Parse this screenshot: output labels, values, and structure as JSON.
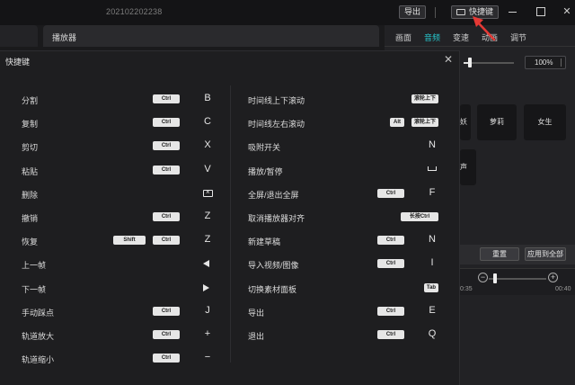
{
  "titlebar": {
    "project_name": "202102202238",
    "export_label": "导出",
    "shortcuts_label": "快捷键"
  },
  "player": {
    "title": "播放器"
  },
  "right_panel": {
    "tabs": [
      {
        "label": "画面",
        "active": false
      },
      {
        "label": "音频",
        "active": true
      },
      {
        "label": "变速",
        "active": false
      },
      {
        "label": "动画",
        "active": false
      },
      {
        "label": "调节",
        "active": false
      }
    ],
    "volume_percent": "100%",
    "volume_level": 0.1,
    "voices": [
      "妖",
      "萝莉",
      "女生",
      "声"
    ],
    "reset_label": "重置",
    "apply_all_label": "应用到全部",
    "timeline_times": [
      "0:35",
      "00:40"
    ]
  },
  "dialog": {
    "title": "快捷键",
    "left_column": [
      {
        "name": "分割",
        "mods": [
          "Ctrl"
        ],
        "key": "B"
      },
      {
        "name": "复制",
        "mods": [
          "Ctrl"
        ],
        "key": "C"
      },
      {
        "name": "剪切",
        "mods": [
          "Ctrl"
        ],
        "key": "X"
      },
      {
        "name": "粘贴",
        "mods": [
          "Ctrl"
        ],
        "key": "V"
      },
      {
        "name": "删除",
        "mods": [],
        "key": "",
        "glyph": "delete-key-icon"
      },
      {
        "name": "撤销",
        "mods": [
          "Ctrl"
        ],
        "key": "Z"
      },
      {
        "name": "恢复",
        "mods": [
          "Shift",
          "Ctrl"
        ],
        "key": "Z"
      },
      {
        "name": "上一帧",
        "mods": [],
        "key": "",
        "glyph": "arrow-left-icon"
      },
      {
        "name": "下一帧",
        "mods": [],
        "key": "",
        "glyph": "arrow-right-icon"
      },
      {
        "name": "手动踩点",
        "mods": [
          "Ctrl"
        ],
        "key": "J"
      },
      {
        "name": "轨道放大",
        "mods": [
          "Ctrl"
        ],
        "key": "+"
      },
      {
        "name": "轨道缩小",
        "mods": [
          "Ctrl"
        ],
        "key": "−"
      }
    ],
    "right_column": [
      {
        "name": "时间线上下滚动",
        "mods": [
          "滚轮上下"
        ],
        "key": ""
      },
      {
        "name": "时间线左右滚动",
        "mods": [
          "Alt",
          "滚轮上下"
        ],
        "key": ""
      },
      {
        "name": "吸附开关",
        "mods": [],
        "key": "N"
      },
      {
        "name": "播放/暂停",
        "mods": [],
        "key": "",
        "glyph": "space-key-icon"
      },
      {
        "name": "全屏/退出全屏",
        "mods": [
          "Ctrl"
        ],
        "key": "F"
      },
      {
        "name": "取消播放器对齐",
        "mods": [
          "长按Ctrl"
        ],
        "key": ""
      },
      {
        "name": "新建草稿",
        "mods": [
          "Ctrl"
        ],
        "key": "N"
      },
      {
        "name": "导入视频/图像",
        "mods": [
          "Ctrl"
        ],
        "key": "I"
      },
      {
        "name": "切换素材面板",
        "mods": [
          "Tab"
        ],
        "key": ""
      },
      {
        "name": "导出",
        "mods": [
          "Ctrl"
        ],
        "key": "E"
      },
      {
        "name": "退出",
        "mods": [
          "Ctrl"
        ],
        "key": "Q"
      }
    ]
  },
  "colors": {
    "accent": "#27c3c9",
    "arrow": "#e53935"
  }
}
